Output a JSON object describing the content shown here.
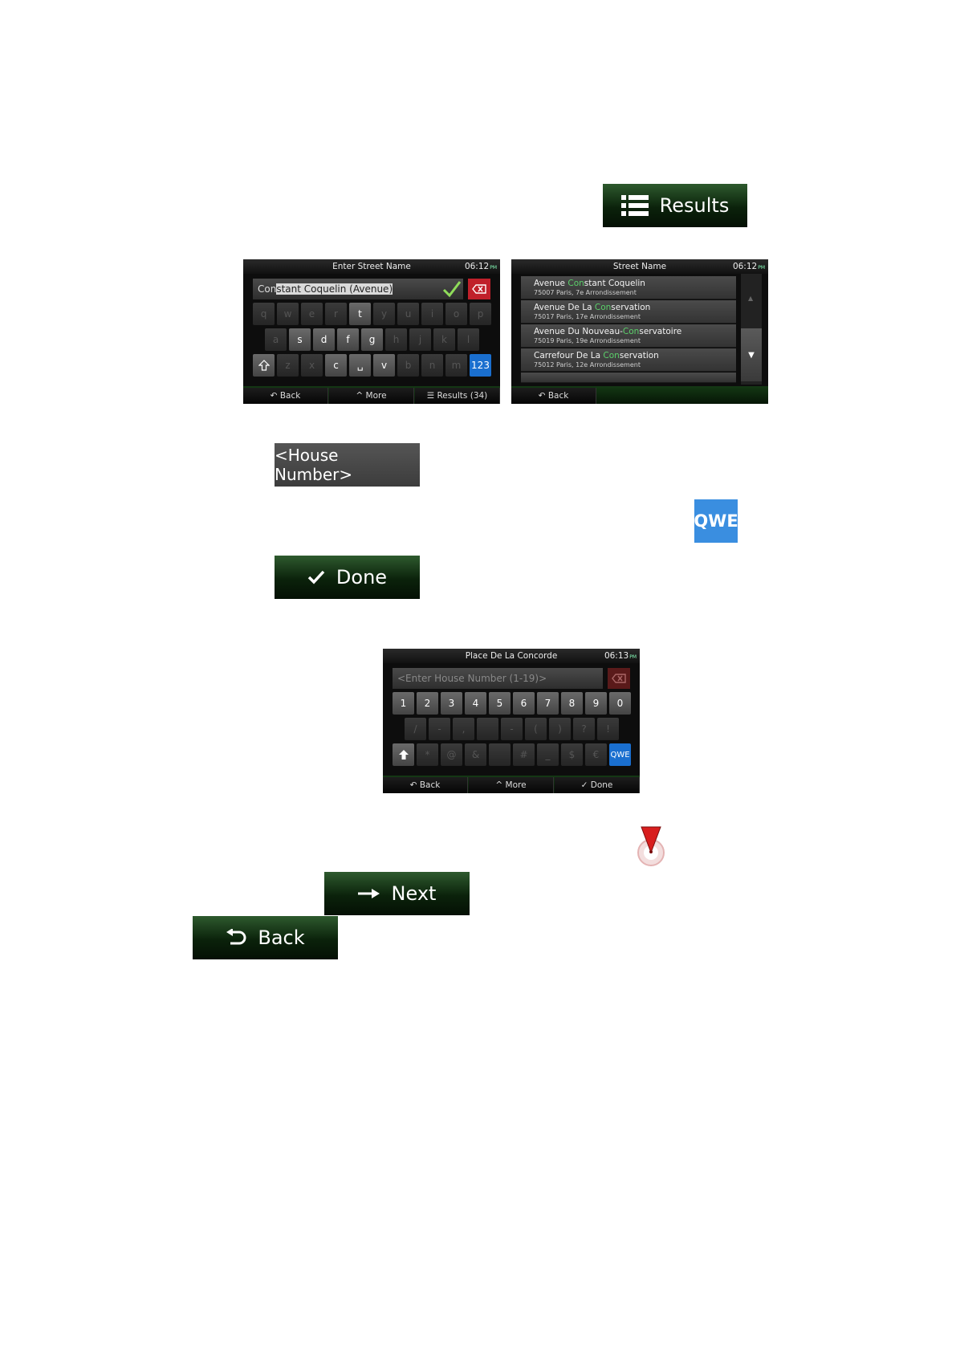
{
  "buttons": {
    "results": "Results",
    "house_number": "<House Number>",
    "qwe": "QWE",
    "done": "Done",
    "next": "Next",
    "back": "Back"
  },
  "screen1": {
    "title": "Enter Street Name",
    "time": "06:12",
    "ampm": "PM",
    "input_typed": "Con",
    "input_completion": "stant Coquelin (Avenue)",
    "row1": [
      "q",
      "w",
      "e",
      "r",
      "t",
      "y",
      "u",
      "i",
      "o",
      "p"
    ],
    "row2": [
      "a",
      "s",
      "d",
      "f",
      "g",
      "h",
      "j",
      "k",
      "l"
    ],
    "row3": [
      "z",
      "x",
      "c",
      "␣",
      "v",
      "b",
      "n",
      "m"
    ],
    "numeric_key": "123",
    "bottom": {
      "back": "Back",
      "more": "More",
      "results": "Results (34)"
    }
  },
  "screen2": {
    "title": "Street Name",
    "time": "06:12",
    "ampm": "PM",
    "items": [
      {
        "pre": "Avenue ",
        "match": "Con",
        "post": "stant Coquelin",
        "sub": "75007 Paris, 7e Arrondissement"
      },
      {
        "pre": "Avenue De La ",
        "match": "Con",
        "post": "servation",
        "sub": "75017 Paris, 17e Arrondissement"
      },
      {
        "pre": "Avenue Du Nouveau-",
        "match": "Con",
        "post": "servatoire",
        "sub": "75019 Paris, 19e Arrondissement"
      },
      {
        "pre": "Carrefour De La ",
        "match": "Con",
        "post": "servation",
        "sub": "75012 Paris, 12e Arrondissement"
      }
    ],
    "bottom": {
      "back": "Back"
    }
  },
  "screen3": {
    "title": "Place De La Concorde",
    "time": "06:13",
    "ampm": "PM",
    "placeholder": "<Enter House Number (1-19)>",
    "row1": [
      "1",
      "2",
      "3",
      "4",
      "5",
      "6",
      "7",
      "8",
      "9",
      "0"
    ],
    "row2": [
      "/",
      "-",
      ",",
      "",
      "-",
      "(",
      ")",
      "?",
      "!"
    ],
    "row3": [
      "*",
      "@",
      "&",
      "",
      "#",
      "_",
      "$",
      "€"
    ],
    "qwe_key": "QWE",
    "bottom": {
      "back": "Back",
      "more": "More",
      "done": "Done"
    }
  }
}
